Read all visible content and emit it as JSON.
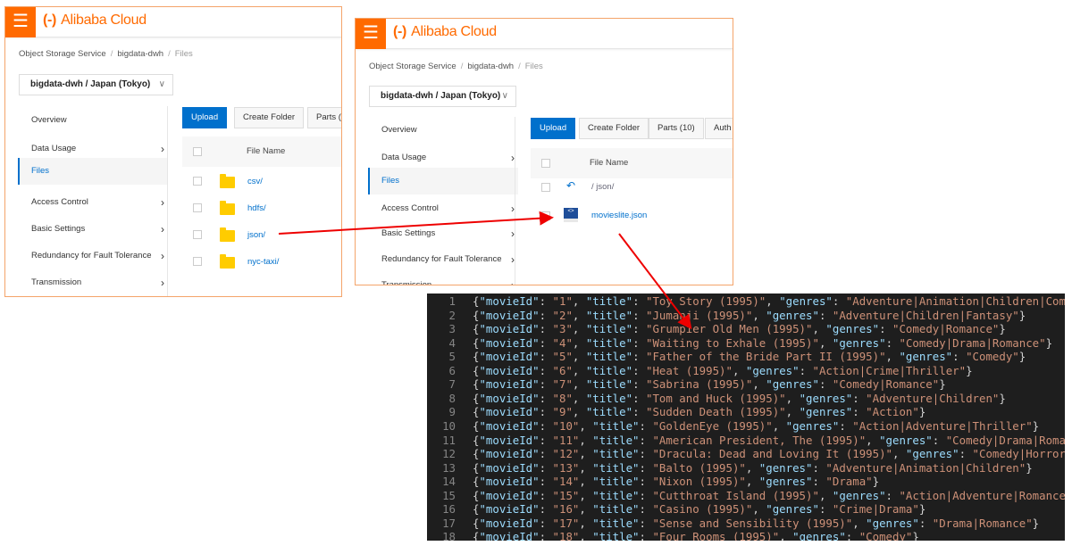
{
  "brand": {
    "logo_mark": "(-)",
    "logo_text": "Alibaba Cloud",
    "accent": "#ff6a00",
    "link": "#0070cc"
  },
  "panel1": {
    "breadcrumb": [
      "Object Storage Service",
      "bigdata-dwh",
      "Files"
    ],
    "bucket_select": "bigdata-dwh / Japan (Tokyo)",
    "sidebar": [
      {
        "label": "Overview",
        "arrow": false
      },
      {
        "label": "Data Usage",
        "arrow": true
      },
      {
        "label": "Files",
        "arrow": false,
        "active": true
      },
      {
        "label": "Access Control",
        "arrow": true
      },
      {
        "label": "Basic Settings",
        "arrow": true
      },
      {
        "label": "Redundancy for Fault Tolerance",
        "arrow": true
      },
      {
        "label": "Transmission",
        "arrow": true
      }
    ],
    "toolbar": {
      "upload": "Upload",
      "create_folder": "Create Folder",
      "parts": "Parts ("
    },
    "column_header": "File Name",
    "files": [
      "csv/",
      "hdfs/",
      "json/",
      "nyc-taxi/"
    ]
  },
  "panel2": {
    "breadcrumb": [
      "Object Storage Service",
      "bigdata-dwh",
      "Files"
    ],
    "bucket_select": "bigdata-dwh / Japan (Tokyo)",
    "sidebar": [
      {
        "label": "Overview",
        "arrow": false
      },
      {
        "label": "Data Usage",
        "arrow": true
      },
      {
        "label": "Files",
        "arrow": false,
        "active": true
      },
      {
        "label": "Access Control",
        "arrow": true
      },
      {
        "label": "Basic Settings",
        "arrow": true
      },
      {
        "label": "Redundancy for Fault Tolerance",
        "arrow": true
      },
      {
        "label": "Transmission",
        "arrow": true
      }
    ],
    "toolbar": {
      "upload": "Upload",
      "create_folder": "Create Folder",
      "parts": "Parts (10)",
      "auth": "Auth"
    },
    "column_header": "File Name",
    "path": "/ json/",
    "file": "movieslite.json"
  },
  "editor": {
    "lines": [
      {
        "id": "1",
        "title": "Toy Story (1995)",
        "genres": "Adventure|Animation|Children|Comedy|Fantasy"
      },
      {
        "id": "2",
        "title": "Jumanji (1995)",
        "genres": "Adventure|Children|Fantasy"
      },
      {
        "id": "3",
        "title": "Grumpier Old Men (1995)",
        "genres": "Comedy|Romance"
      },
      {
        "id": "4",
        "title": "Waiting to Exhale (1995)",
        "genres": "Comedy|Drama|Romance"
      },
      {
        "id": "5",
        "title": "Father of the Bride Part II (1995)",
        "genres": "Comedy"
      },
      {
        "id": "6",
        "title": "Heat (1995)",
        "genres": "Action|Crime|Thriller"
      },
      {
        "id": "7",
        "title": "Sabrina (1995)",
        "genres": "Comedy|Romance"
      },
      {
        "id": "8",
        "title": "Tom and Huck (1995)",
        "genres": "Adventure|Children"
      },
      {
        "id": "9",
        "title": "Sudden Death (1995)",
        "genres": "Action"
      },
      {
        "id": "10",
        "title": "GoldenEye (1995)",
        "genres": "Action|Adventure|Thriller"
      },
      {
        "id": "11",
        "title": "American President, The (1995)",
        "genres": "Comedy|Drama|Romance"
      },
      {
        "id": "12",
        "title": "Dracula: Dead and Loving It (1995)",
        "genres": "Comedy|Horror"
      },
      {
        "id": "13",
        "title": "Balto (1995)",
        "genres": "Adventure|Animation|Children"
      },
      {
        "id": "14",
        "title": "Nixon (1995)",
        "genres": "Drama"
      },
      {
        "id": "15",
        "title": "Cutthroat Island (1995)",
        "genres": "Action|Adventure|Romance"
      },
      {
        "id": "16",
        "title": "Casino (1995)",
        "genres": "Crime|Drama"
      },
      {
        "id": "17",
        "title": "Sense and Sensibility (1995)",
        "genres": "Drama|Romance"
      },
      {
        "id": "18",
        "title": "Four Rooms (1995)",
        "genres": "Comedy"
      }
    ]
  }
}
